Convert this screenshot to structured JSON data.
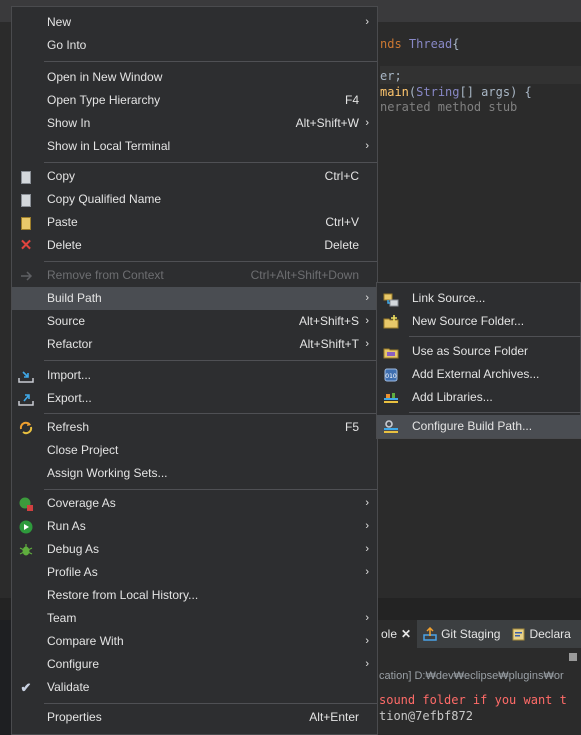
{
  "editor": {
    "code": {
      "line1_a": "nds ",
      "line1_b": "Thread",
      "line1_c": "{",
      "line2": "er;",
      "line3_a": "main",
      "line3_b": "(",
      "line3_c": "String",
      "line3_d": "[] args) {",
      "line4": "nerated method stub"
    }
  },
  "console": {
    "tabs": [
      {
        "label": "ole",
        "close": "✕"
      },
      {
        "label": "Git Staging"
      },
      {
        "label": "Declara"
      }
    ],
    "path": "cation] D:₩dev₩eclipse₩plugins₩or",
    "out_line1": "sound folder if you want t",
    "out_line2": "tion@7efbf872"
  },
  "context_menu": {
    "items": [
      {
        "label": "New",
        "shortcut": "",
        "submenu": true,
        "icon": ""
      },
      {
        "label": "Go Into",
        "shortcut": "",
        "submenu": false,
        "icon": ""
      },
      {
        "label": "Open in New Window",
        "shortcut": "",
        "submenu": false,
        "icon": ""
      },
      {
        "label": "Open Type Hierarchy",
        "shortcut": "F4",
        "submenu": false,
        "icon": ""
      },
      {
        "label": "Show In",
        "shortcut": "Alt+Shift+W",
        "submenu": true,
        "icon": ""
      },
      {
        "label": "Show in Local Terminal",
        "shortcut": "",
        "submenu": true,
        "icon": ""
      },
      {
        "label": "Copy",
        "shortcut": "Ctrl+C",
        "submenu": false,
        "icon": "copy-icon"
      },
      {
        "label": "Copy Qualified Name",
        "shortcut": "",
        "submenu": false,
        "icon": "copy-qualified-icon"
      },
      {
        "label": "Paste",
        "shortcut": "Ctrl+V",
        "submenu": false,
        "icon": "paste-icon"
      },
      {
        "label": "Delete",
        "shortcut": "Delete",
        "submenu": false,
        "icon": "delete-icon"
      },
      {
        "label": "Remove from Context",
        "shortcut": "Ctrl+Alt+Shift+Down",
        "submenu": false,
        "icon": "remove-context-icon",
        "disabled": true
      },
      {
        "label": "Build Path",
        "shortcut": "",
        "submenu": true,
        "icon": "",
        "hover": true
      },
      {
        "label": "Source",
        "shortcut": "Alt+Shift+S",
        "submenu": true,
        "icon": ""
      },
      {
        "label": "Refactor",
        "shortcut": "Alt+Shift+T",
        "submenu": true,
        "icon": ""
      },
      {
        "label": "Import...",
        "shortcut": "",
        "submenu": false,
        "icon": "import-icon"
      },
      {
        "label": "Export...",
        "shortcut": "",
        "submenu": false,
        "icon": "export-icon"
      },
      {
        "label": "Refresh",
        "shortcut": "F5",
        "submenu": false,
        "icon": "refresh-icon"
      },
      {
        "label": "Close Project",
        "shortcut": "",
        "submenu": false,
        "icon": ""
      },
      {
        "label": "Assign Working Sets...",
        "shortcut": "",
        "submenu": false,
        "icon": ""
      },
      {
        "label": "Coverage As",
        "shortcut": "",
        "submenu": true,
        "icon": "coverage-icon"
      },
      {
        "label": "Run As",
        "shortcut": "",
        "submenu": true,
        "icon": "run-icon"
      },
      {
        "label": "Debug As",
        "shortcut": "",
        "submenu": true,
        "icon": "debug-icon"
      },
      {
        "label": "Profile As",
        "shortcut": "",
        "submenu": true,
        "icon": ""
      },
      {
        "label": "Restore from Local History...",
        "shortcut": "",
        "submenu": false,
        "icon": ""
      },
      {
        "label": "Team",
        "shortcut": "",
        "submenu": true,
        "icon": ""
      },
      {
        "label": "Compare With",
        "shortcut": "",
        "submenu": true,
        "icon": ""
      },
      {
        "label": "Configure",
        "shortcut": "",
        "submenu": true,
        "icon": ""
      },
      {
        "label": "Validate",
        "shortcut": "",
        "submenu": false,
        "icon": "validate-icon"
      },
      {
        "label": "Properties",
        "shortcut": "Alt+Enter",
        "submenu": false,
        "icon": ""
      }
    ],
    "arrow": "›"
  },
  "build_path_submenu": {
    "items": [
      {
        "label": "Link Source...",
        "icon": "link-source-icon"
      },
      {
        "label": "New Source Folder...",
        "icon": "new-source-folder-icon"
      },
      {
        "label": "Use as Source Folder",
        "icon": "use-source-folder-icon"
      },
      {
        "label": "Add External Archives...",
        "icon": "external-archives-icon"
      },
      {
        "label": "Add Libraries...",
        "icon": "add-libraries-icon"
      },
      {
        "label": "Configure Build Path...",
        "icon": "configure-build-path-icon",
        "hover": true
      }
    ]
  },
  "colors": {
    "menu_bg": "#2d2e30",
    "hover_bg": "#4a4d52",
    "text": "#e4e4e4",
    "disabled_text": "#6d6e71"
  }
}
